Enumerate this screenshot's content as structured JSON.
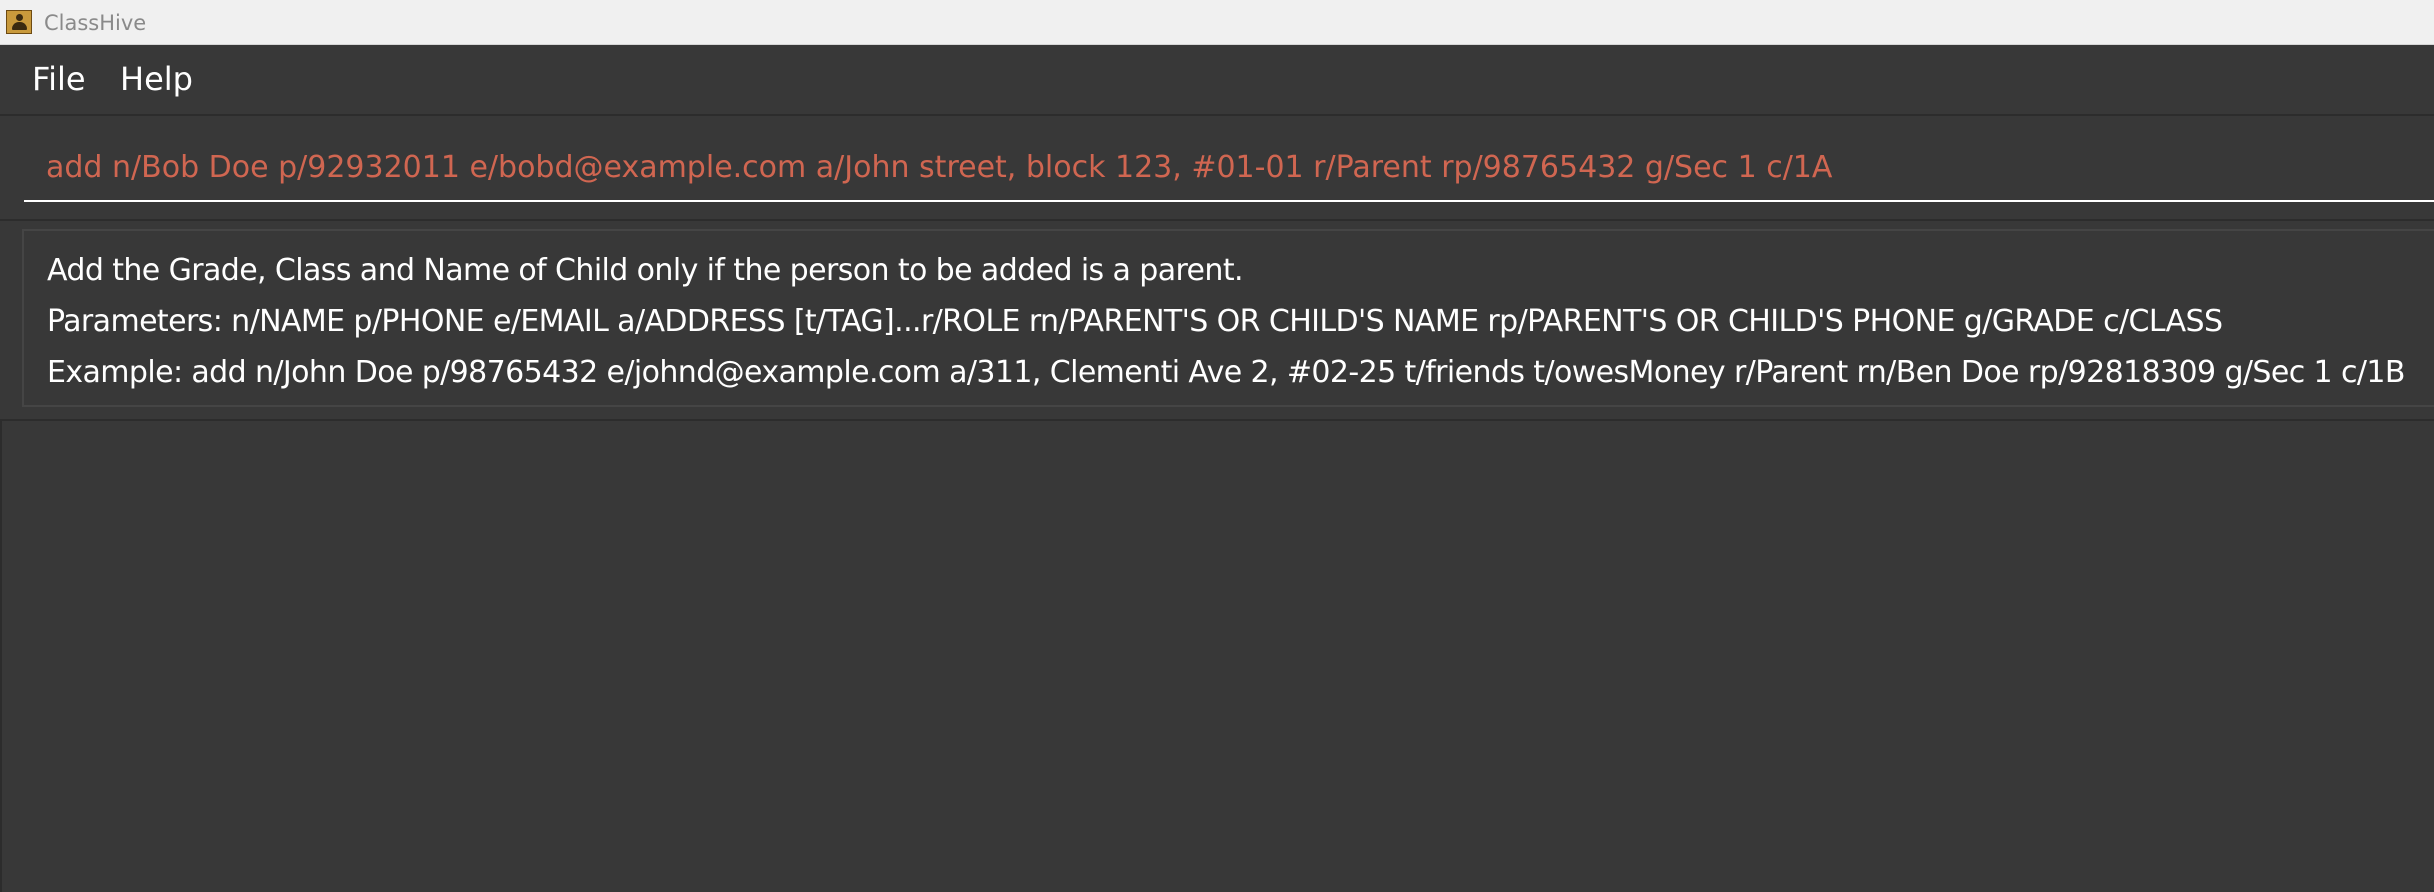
{
  "window": {
    "title": "ClassHive",
    "icon": "app-icon"
  },
  "menu": {
    "items": [
      {
        "label": "File"
      },
      {
        "label": "Help"
      }
    ]
  },
  "command_box": {
    "value": "add n/Bob Doe p/92932011 e/bobd@example.com a/John street, block 123, #01-01 r/Parent rp/98765432 g/Sec 1 c/1A",
    "text_color": "#d06651"
  },
  "result_display": {
    "lines": [
      "Add the Grade, Class and Name of Child only if the person to be added is a parent.",
      "Parameters: n/NAME p/PHONE e/EMAIL a/ADDRESS [t/TAG]...r/ROLE rn/PARENT'S OR CHILD'S NAME rp/PARENT'S OR CHILD'S PHONE g/GRADE c/CLASS",
      "Example: add n/John Doe p/98765432 e/johnd@example.com a/311, Clementi Ave 2, #02-25 t/friends t/owesMoney r/Parent rn/Ben Doe rp/92818309 g/Sec 1 c/1B"
    ]
  },
  "theme": {
    "background": "#383838",
    "text": "#ffffff",
    "error_text": "#d06651"
  }
}
